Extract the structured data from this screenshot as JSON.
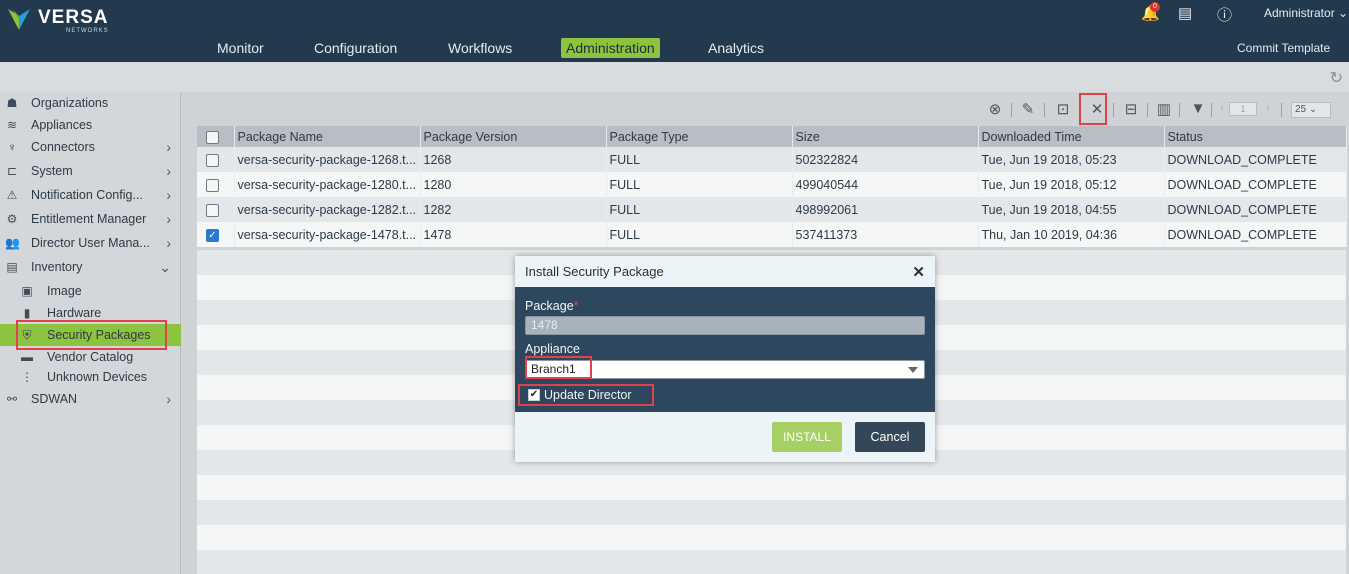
{
  "brand": {
    "name": "VERSA",
    "tagline": "NETWORKS"
  },
  "header": {
    "nav": [
      "Monitor",
      "Configuration",
      "Workflows",
      "Administration",
      "Analytics"
    ],
    "active_nav": "Administration",
    "notification_count": "0",
    "user": "Administrator",
    "commit_template": "Commit Template"
  },
  "sidebar": {
    "items": [
      {
        "label": "Organizations",
        "icon": "org-icon"
      },
      {
        "label": "Appliances",
        "icon": "appliances-icon"
      },
      {
        "label": "Connectors",
        "icon": "connectors-icon"
      },
      {
        "label": "System",
        "icon": "system-icon"
      },
      {
        "label": "Notification Config...",
        "icon": "notification-icon"
      },
      {
        "label": "Entitlement Manager",
        "icon": "entitlement-icon"
      },
      {
        "label": "Director User Mana...",
        "icon": "users-icon"
      },
      {
        "label": "Inventory",
        "icon": "inventory-icon"
      },
      {
        "label": "Image",
        "icon": "image-icon"
      },
      {
        "label": "Hardware",
        "icon": "hardware-icon"
      },
      {
        "label": "Security Packages",
        "icon": "security-icon"
      },
      {
        "label": "Vendor Catalog",
        "icon": "catalog-icon"
      },
      {
        "label": "Unknown Devices",
        "icon": "unknown-devices-icon"
      },
      {
        "label": "SDWAN",
        "icon": "sdwan-icon"
      }
    ]
  },
  "toolbar": {
    "page_number": "1",
    "page_size": "25"
  },
  "table": {
    "columns": [
      "Package Name",
      "Package Version",
      "Package Type",
      "Size",
      "Downloaded Time",
      "Status"
    ],
    "rows": [
      {
        "name": "versa-security-package-1268.t...",
        "version": "1268",
        "type": "FULL",
        "size": "502322824",
        "time": "Tue, Jun 19 2018, 05:23",
        "status": "DOWNLOAD_COMPLETE",
        "checked": false
      },
      {
        "name": "versa-security-package-1280.t...",
        "version": "1280",
        "type": "FULL",
        "size": "499040544",
        "time": "Tue, Jun 19 2018, 05:12",
        "status": "DOWNLOAD_COMPLETE",
        "checked": false
      },
      {
        "name": "versa-security-package-1282.t...",
        "version": "1282",
        "type": "FULL",
        "size": "498992061",
        "time": "Tue, Jun 19 2018, 04:55",
        "status": "DOWNLOAD_COMPLETE",
        "checked": false
      },
      {
        "name": "versa-security-package-1478.t...",
        "version": "1478",
        "type": "FULL",
        "size": "537411373",
        "time": "Thu, Jan 10 2019, 04:36",
        "status": "DOWNLOAD_COMPLETE",
        "checked": true
      }
    ]
  },
  "modal": {
    "title": "Install Security Package",
    "package_label": "Package",
    "package_required": "*",
    "package_value": "1478",
    "appliance_label": "Appliance",
    "appliance_value": "Branch1",
    "update_director_label": "Update Director",
    "install_label": "INSTALL",
    "cancel_label": "Cancel"
  },
  "colors": {
    "header_bg": "#23394d",
    "accent_green": "#8cc43f",
    "highlight_red": "#e0424a",
    "modal_bg": "#2c475e"
  }
}
